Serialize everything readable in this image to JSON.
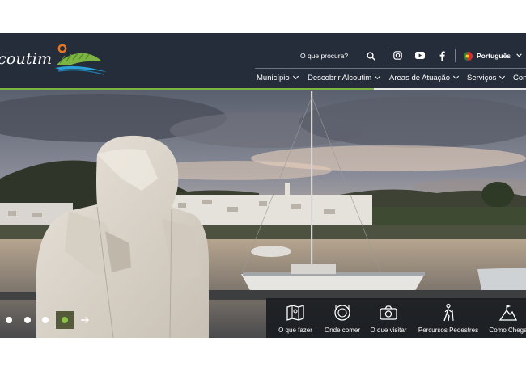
{
  "header": {
    "logo_text": "coutim",
    "search_label": "O que procura?",
    "language": "Português",
    "icons": [
      "search-icon",
      "instagram-icon",
      "youtube-icon",
      "facebook-icon",
      "portugal-flag-icon",
      "chevron-down-icon"
    ],
    "colors": {
      "header_bg": "#262d3a",
      "accent_green": "#7cb342",
      "logo_orange": "#e87722",
      "logo_blue": "#2a9fd8"
    }
  },
  "nav": {
    "items": [
      {
        "label": "Município"
      },
      {
        "label": "Descobrir Alcoutim"
      },
      {
        "label": "Áreas de Atuação"
      },
      {
        "label": "Serviços"
      },
      {
        "label": "Con"
      }
    ]
  },
  "slider": {
    "slide_count": 5,
    "active_index": 4
  },
  "quick_links": [
    {
      "label": "O que fazer",
      "icon": "map-icon"
    },
    {
      "label": "Onde comer",
      "icon": "dish-icon"
    },
    {
      "label": "O que visitar",
      "icon": "camera-icon"
    },
    {
      "label": "Percursos Pedestres",
      "icon": "hiker-icon"
    },
    {
      "label": "Como Chega",
      "icon": "mountain-flag-icon"
    }
  ]
}
